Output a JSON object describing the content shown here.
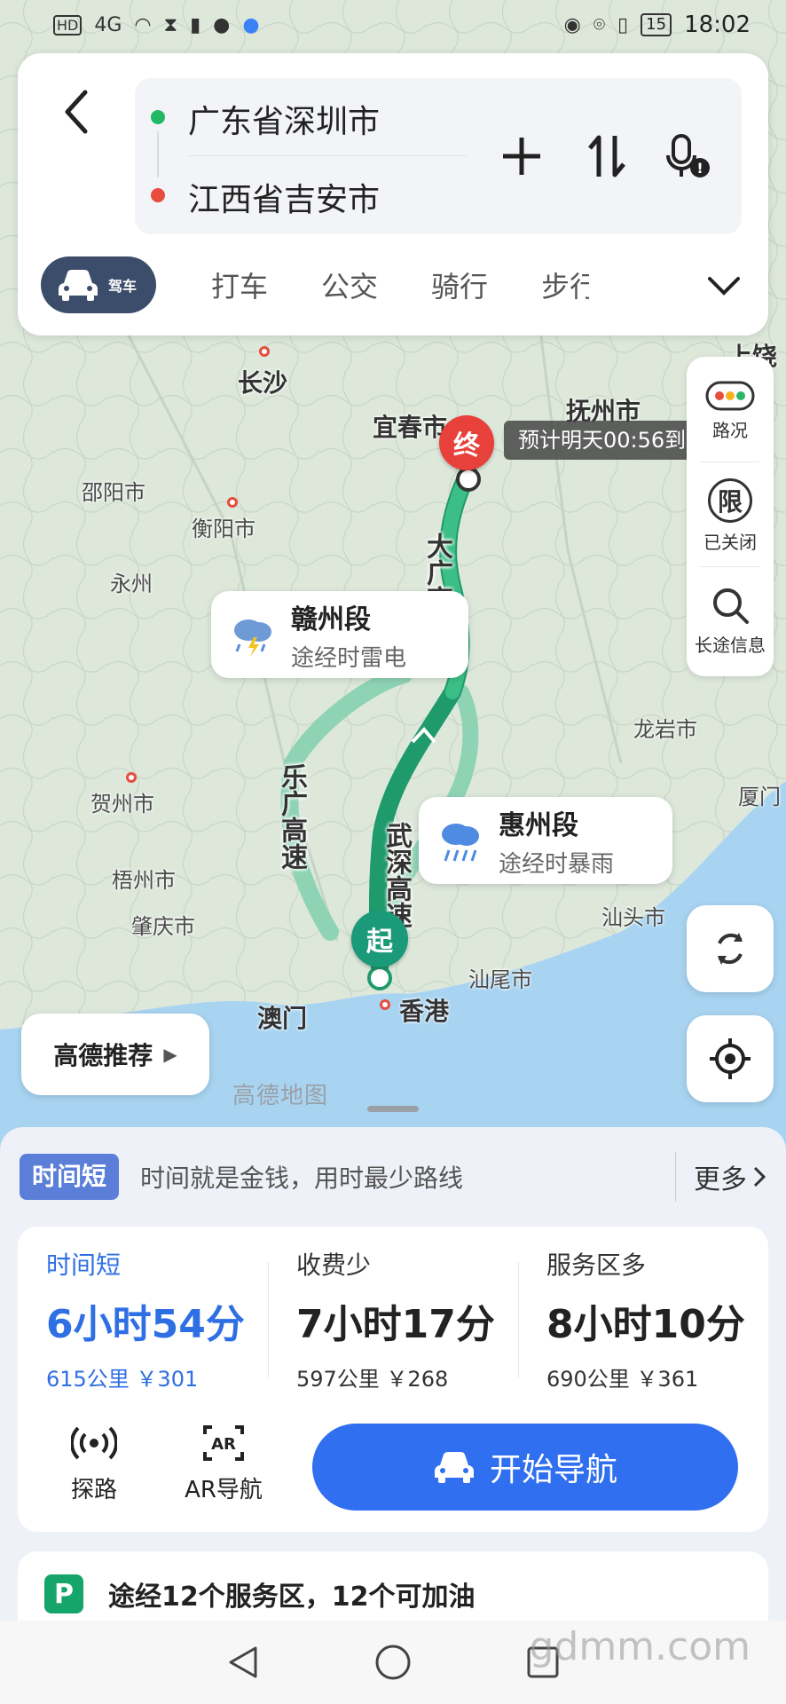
{
  "status_bar": {
    "network": "HD",
    "signal": "4G",
    "battery": "15",
    "time": "18:02"
  },
  "header": {
    "origin": "广东省深圳市",
    "destination": "江西省吉安市",
    "modes": [
      "驾车",
      "打车",
      "公交",
      "骑行",
      "步行"
    ]
  },
  "side_panel": {
    "traffic": "路况",
    "restrict": "已关闭",
    "restrict_glyph": "限",
    "long_trip": "长途信息"
  },
  "map": {
    "cities": {
      "changsha": "长沙",
      "yichun": "宜春市",
      "fuzhou": "抚州市",
      "shaoyang": "邵阳市",
      "hengyang": "衡阳市",
      "yongzhou": "永州",
      "longyan": "龙岩市",
      "hezhou": "贺州市",
      "wuzhou": "梧州市",
      "zhaoqing": "肇庆市",
      "shantou": "汕头市",
      "shanwei": "汕尾市",
      "macau": "澳门",
      "hongkong": "香港",
      "xiamen": "厦门",
      "shangrao": "上饶"
    },
    "roads": {
      "daguang": "大广高速",
      "leguang": "乐广高速",
      "wushen": "武深高速"
    },
    "weather_ganzhou": {
      "title": "赣州段",
      "desc": "途经时雷电"
    },
    "weather_huizhou": {
      "title": "惠州段",
      "desc": "途经时暴雨"
    },
    "eta": "预计明天00:56到",
    "end_label": "终",
    "start_label": "起",
    "recommend": "高德推荐",
    "watermark": "高德地图"
  },
  "sheet": {
    "tip_tag": "时间短",
    "tip_text": "时间就是金钱，用时最少路线",
    "more": "更多",
    "routes": [
      {
        "name": "时间短",
        "duration": "6小时54分",
        "meta": "615公里 ￥301"
      },
      {
        "name": "收费少",
        "duration": "7小时17分",
        "meta": "597公里 ￥268"
      },
      {
        "name": "服务区多",
        "duration": "8小时10分",
        "meta": "690公里 ￥361"
      }
    ],
    "tools": {
      "explore": "探路",
      "ar": "AR导航"
    },
    "start_nav": "开始导航",
    "service": "途经12个服务区，12个可加油"
  },
  "site_watermark": "gdmm.com",
  "colors": {
    "accent": "#2f6ff0",
    "route_main": "#1f9a6b",
    "route_alt": "#8fd3b5",
    "end": "#e8403b"
  }
}
